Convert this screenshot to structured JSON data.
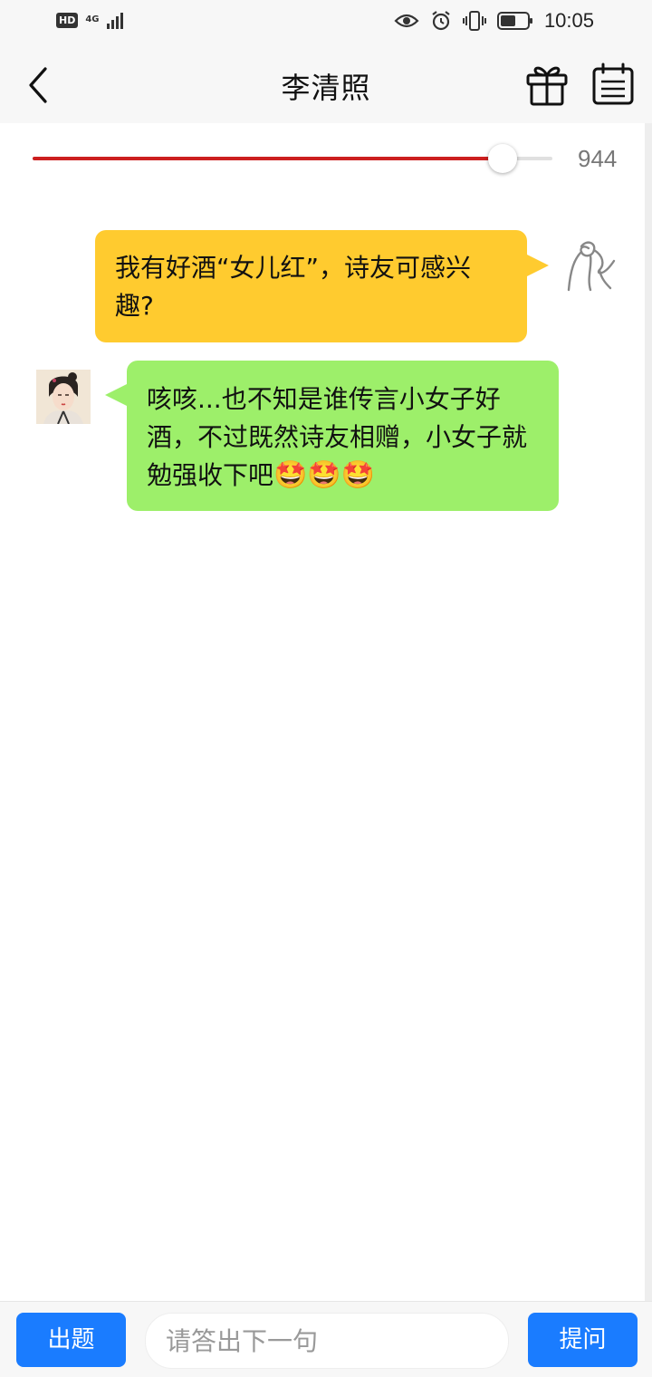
{
  "status_bar": {
    "hd": "HD",
    "network": "4G",
    "time": "10:05",
    "icons": [
      "hd-icon",
      "signal-icon",
      "eye-icon",
      "alarm-icon",
      "vibrate-icon",
      "battery-icon"
    ]
  },
  "header": {
    "title": "李清照",
    "icons": [
      "back-chevron-icon",
      "gift-icon",
      "calendar-icon"
    ]
  },
  "slider": {
    "value_label": "944",
    "level": 0.904,
    "fill_color": "#cc1f1f"
  },
  "messages": [
    {
      "sender": "user",
      "text": "我有好酒“女儿红”，诗友可感兴趣?",
      "bubble_color": "#ffcb2f"
    },
    {
      "sender": "bot",
      "text": "咳咳...也不知是谁传言小女子好酒，不过既然诗友相赠，小女子就勉强收下吧",
      "emojis": "🤩🤩🤩",
      "bubble_color": "#9def6a"
    }
  ],
  "bottom_bar": {
    "left_button": "出题",
    "input_placeholder": "请答出下一句",
    "right_button": "提问",
    "accent": "#1a7cff"
  }
}
